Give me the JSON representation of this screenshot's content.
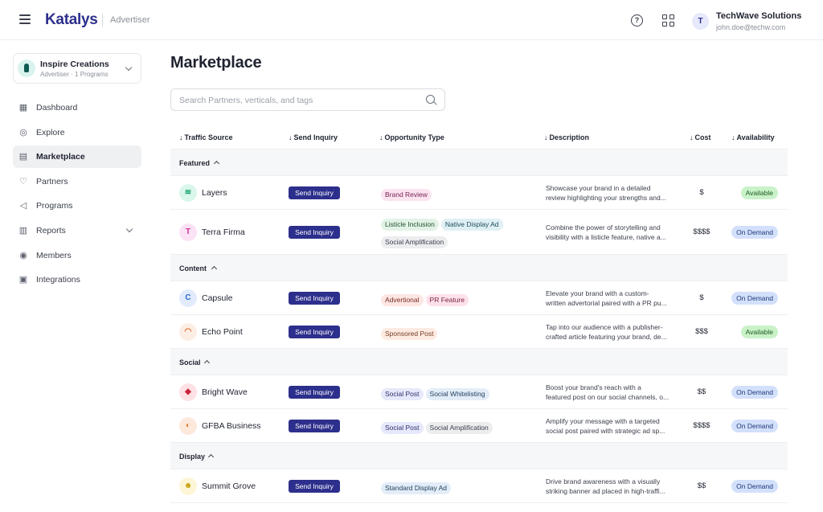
{
  "header": {
    "logo": "Katalys",
    "sub": "Advertiser",
    "help_icon": "?",
    "user": {
      "initial": "T",
      "name": "TechWave Solutions",
      "email": "john.doe@techw.com"
    }
  },
  "org": {
    "name": "Inspire Creations",
    "sub": "Advertiser · 1 Programs"
  },
  "nav": [
    {
      "label": "Dashboard",
      "icon": "dashboard-icon",
      "glyph": "▦"
    },
    {
      "label": "Explore",
      "icon": "compass-icon",
      "glyph": "◎"
    },
    {
      "label": "Marketplace",
      "icon": "marketplace-icon",
      "glyph": "▤",
      "active": true
    },
    {
      "label": "Partners",
      "icon": "handshake-icon",
      "glyph": "♡"
    },
    {
      "label": "Programs",
      "icon": "megaphone-icon",
      "glyph": "◁"
    },
    {
      "label": "Reports",
      "icon": "reports-icon",
      "glyph": "▥",
      "expandable": true
    },
    {
      "label": "Members",
      "icon": "members-icon",
      "glyph": "◉"
    },
    {
      "label": "Integrations",
      "icon": "integrations-icon",
      "glyph": "▣"
    }
  ],
  "main": {
    "title": "Marketplace",
    "search_placeholder": "Search Partners, verticals, and tags",
    "columns": {
      "traffic_source": "Traffic Source",
      "send_inquiry": "Send Inquiry",
      "opportunity_type": "Opportunity Type",
      "description": "Description",
      "cost": "Cost",
      "availability": "Availability"
    }
  },
  "colors": {
    "brand": "#2d2f8c",
    "available_bg": "#c9f2c9",
    "available_text": "#1d5c22",
    "ondemand_bg": "#d3e0fb",
    "ondemand_text": "#1e3a7a"
  },
  "groups": [
    {
      "label": "Featured",
      "rows": [
        {
          "name": "Layers",
          "logo_glyph": "≋",
          "logo_bg": "#d9f7ea",
          "logo_fg": "#1ca36f",
          "inquiry": "Send Inquiry",
          "tags": [
            {
              "label": "Brand Review",
              "bg": "#fbe3f0",
              "fg": "#7a2553"
            }
          ],
          "desc": [
            "Showcase your brand in a detailed",
            "review highlighting your strengths and..."
          ],
          "cost": "$",
          "availability": "Available"
        },
        {
          "name": "Terra Firma",
          "logo_glyph": "T",
          "logo_bg": "#fbe3f5",
          "logo_fg": "#d4349b",
          "inquiry": "Send Inquiry",
          "tags": [
            {
              "label": "Listicle Inclusion",
              "bg": "#e2f3e6",
              "fg": "#24522f"
            },
            {
              "label": "Native Display Ad",
              "bg": "#dff0f5",
              "fg": "#1f4d5c"
            },
            {
              "label": "Social Amplification",
              "bg": "#ecedef",
              "fg": "#3a3f4b"
            }
          ],
          "desc": [
            "Combine the power of storytelling and",
            "visibility with a listicle feature, native a..."
          ],
          "cost": "$$$$",
          "availability": "On Demand"
        }
      ]
    },
    {
      "label": "Content",
      "rows": [
        {
          "name": "Capsule",
          "logo_glyph": "C",
          "logo_bg": "#e2ebfb",
          "logo_fg": "#2f6bd6",
          "inquiry": "Send Inquiry",
          "tags": [
            {
              "label": "Advertional",
              "bg": "#fde6e3",
              "fg": "#7a2e25"
            },
            {
              "label": "PR Feature",
              "bg": "#fde1ea",
              "fg": "#7a2540"
            }
          ],
          "desc": [
            "Elevate your brand with a custom-",
            "written advertorial paired with a PR pu..."
          ],
          "cost": "$",
          "availability": "On Demand"
        },
        {
          "name": "Echo Point",
          "logo_glyph": "◠",
          "logo_bg": "#fdeee5",
          "logo_fg": "#e0642a",
          "inquiry": "Send Inquiry",
          "tags": [
            {
              "label": "Sponsored Post",
              "bg": "#fdebe1",
              "fg": "#7a3b25"
            }
          ],
          "desc": [
            "Tap into our audience with a publisher-",
            "crafted article featuring your brand, de..."
          ],
          "cost": "$$$",
          "availability": "Available"
        }
      ]
    },
    {
      "label": "Social",
      "rows": [
        {
          "name": "Bright Wave",
          "logo_glyph": "◆",
          "logo_bg": "#fde1e4",
          "logo_fg": "#c9253a",
          "inquiry": "Send Inquiry",
          "tags": [
            {
              "label": "Social Post",
              "bg": "#e6e8fb",
              "fg": "#2d2f6c"
            },
            {
              "label": "Social Whitelisting",
              "bg": "#e3edf8",
              "fg": "#23415f"
            }
          ],
          "desc": [
            "Boost your brand's reach with a",
            "featured post on our social channels, o..."
          ],
          "cost": "$$",
          "availability": "On Demand"
        },
        {
          "name": "GFBA Business",
          "logo_glyph": "◐",
          "logo_bg": "#fde9dc",
          "logo_fg": "#e07a30",
          "inquiry": "Send Inquiry",
          "tags": [
            {
              "label": "Social Post",
              "bg": "#e6e8fb",
              "fg": "#2d2f6c"
            },
            {
              "label": "Social Amplification",
              "bg": "#ecedef",
              "fg": "#3a3f4b"
            }
          ],
          "desc": [
            "Amplify your message with a targeted",
            "social post paired with strategic ad sp..."
          ],
          "cost": "$$$$",
          "availability": "On Demand"
        }
      ]
    },
    {
      "label": "Display",
      "rows": [
        {
          "name": "Summit Grove",
          "logo_glyph": "☻",
          "logo_bg": "#fdf6d6",
          "logo_fg": "#c9a00e",
          "inquiry": "Send Inquiry",
          "tags": [
            {
              "label": "Standard Display Ad",
              "bg": "#e3edf8",
              "fg": "#23415f"
            }
          ],
          "desc": [
            "Drive brand awareness with a visually",
            "striking banner ad placed in high-traffi..."
          ],
          "cost": "$$",
          "availability": "On Demand"
        }
      ]
    }
  ]
}
